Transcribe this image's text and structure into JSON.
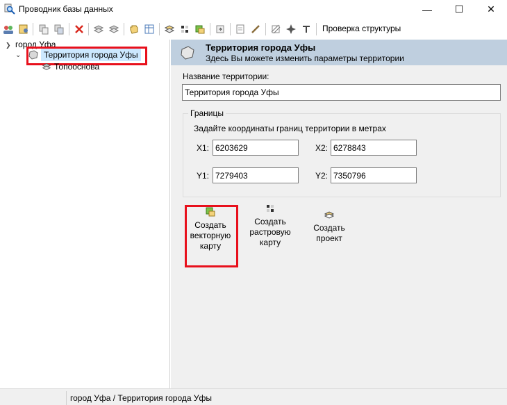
{
  "window": {
    "title": "Проводник базы данных",
    "minimize_glyph": "—",
    "maximize_glyph": "☐",
    "close_glyph": "✕"
  },
  "toolbar": {
    "check_structure_label": "Проверка структуры",
    "icons": [
      "users-icon",
      "user-db-icon",
      "copy-icon",
      "paste-icon",
      "delete-icon",
      "layers-icon",
      "layers-add-icon",
      "hand-icon",
      "db-table-icon",
      "stack-icon",
      "raster-icon",
      "vector-icon",
      "export-icon",
      "sheet-icon",
      "pencil-icon",
      "grid-icon",
      "pin-icon",
      "text-icon"
    ]
  },
  "tree": {
    "root_label": "город Уфа",
    "selected_label": "Территория города Уфы",
    "child_label": "Топооснова"
  },
  "panel": {
    "header_title": "Территория города Уфы",
    "header_subtitle": "Здесь Вы можете изменить параметры территории",
    "name_label": "Название территории:",
    "name_value": "Территория города Уфы",
    "bounds_title": "Границы",
    "bounds_hint": "Задайте координаты границ территории в метрах",
    "x1_label": "X1:",
    "x1_value": "6203629",
    "x2_label": "X2:",
    "x2_value": "6278843",
    "y1_label": "Y1:",
    "y1_value": "7279403",
    "y2_label": "Y2:",
    "y2_value": "7350796",
    "actions": [
      {
        "label_lines": [
          "Создать",
          "векторную",
          "карту"
        ]
      },
      {
        "label_lines": [
          "Создать",
          "растровую",
          "карту"
        ]
      },
      {
        "label_lines": [
          "Создать",
          "проект"
        ]
      }
    ]
  },
  "status": {
    "path": "город Уфа / Территория города Уфы"
  },
  "colors": {
    "selection": "#cce8ff",
    "header_bg": "#bfcfdf",
    "highlight": "#e8101c"
  }
}
